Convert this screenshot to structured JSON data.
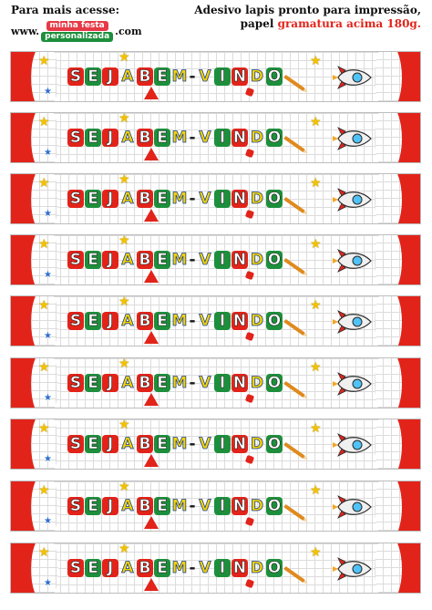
{
  "header": {
    "left_title": "Para mais acesse:",
    "www": "www.",
    "logo_top": "minha festa",
    "logo_bottom": "personalizada",
    "com": ".com",
    "right_line1": "Adesivo lapis pronto para impressão,",
    "right_line2_prefix": "papel ",
    "right_line2_red": "gramatura acima 180g."
  },
  "strip": {
    "text": "SEJA BEM-VINDO",
    "count": 9
  },
  "colors": {
    "red": "#e2231a",
    "yellow": "#f5d400",
    "green": "#1d8f3c",
    "blue": "#2c6fd1"
  },
  "icons": [
    "star-icon",
    "pencil-icon",
    "ruler-triangle-icon",
    "eraser-icon",
    "rocket-icon"
  ]
}
